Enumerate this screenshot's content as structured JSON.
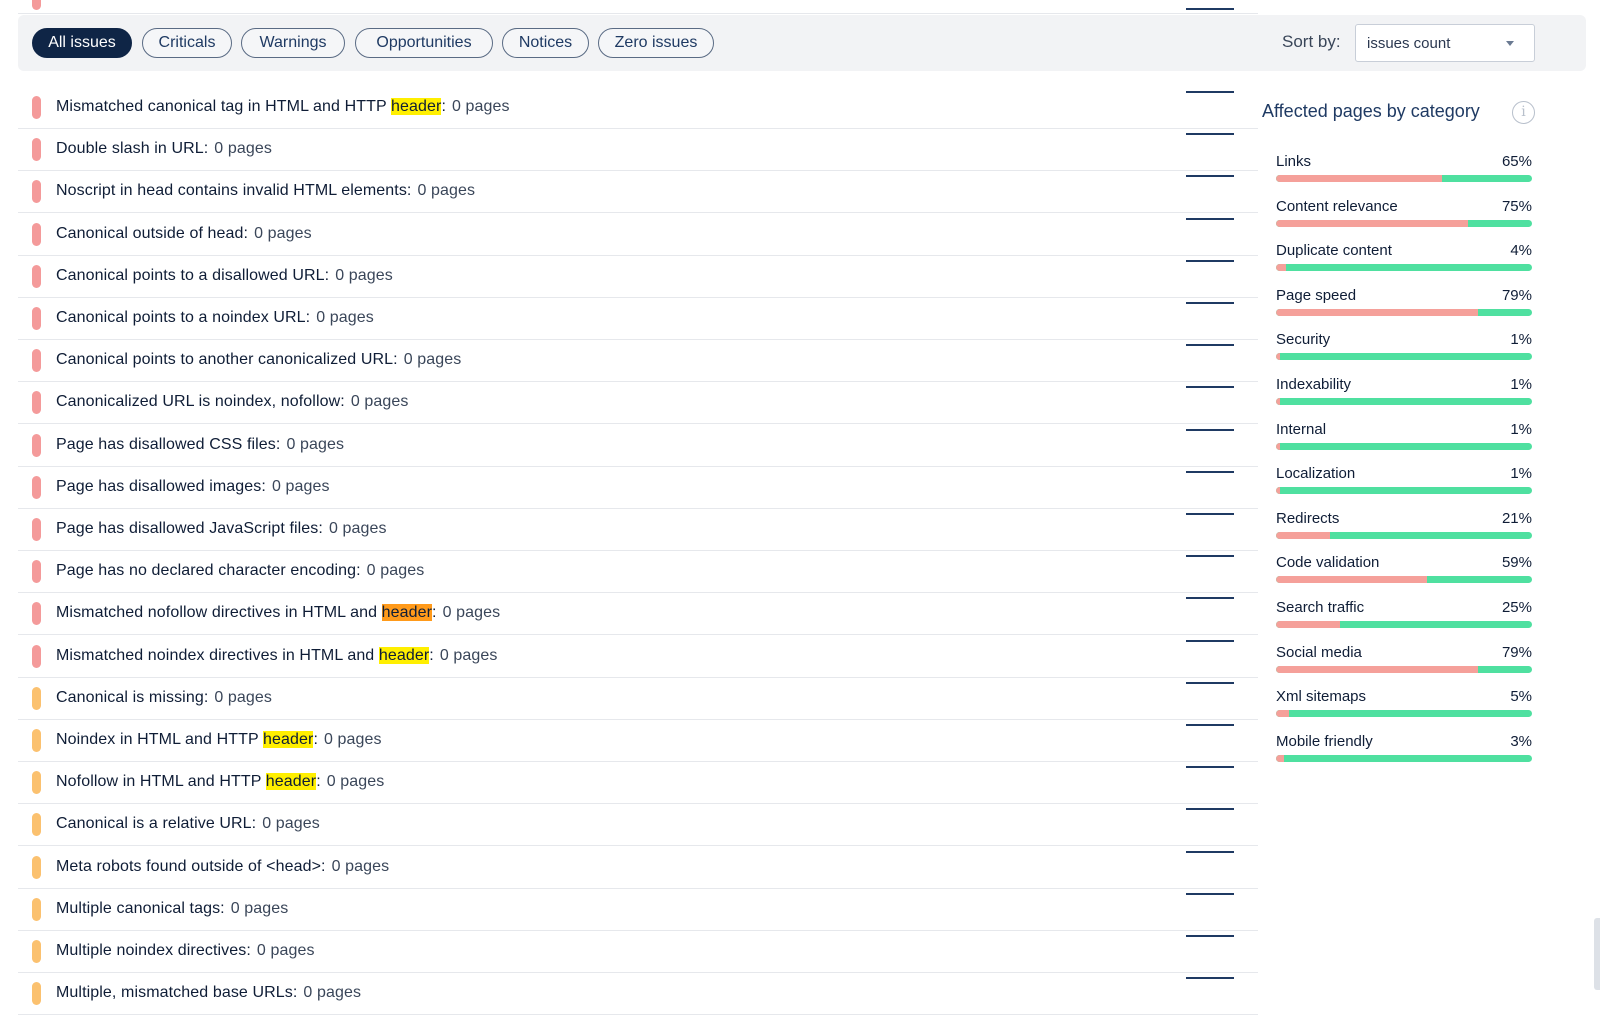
{
  "filters": {
    "chips": [
      {
        "label": "All issues",
        "active": true
      },
      {
        "label": "Criticals",
        "active": false
      },
      {
        "label": "Warnings",
        "active": false
      },
      {
        "label": "Opportunities",
        "active": false
      },
      {
        "label": "Notices",
        "active": false
      },
      {
        "label": "Zero issues",
        "active": false
      }
    ],
    "sort_label": "Sort by:",
    "sort_value": "issues count"
  },
  "issues": [
    {
      "severity": "critical",
      "parts": [
        {
          "text": "Mismatched canonical tag in HTML and HTTP "
        },
        {
          "text": "header",
          "hl": "yellow"
        },
        {
          "text": ":"
        }
      ],
      "count": "0 pages"
    },
    {
      "severity": "critical",
      "parts": [
        {
          "text": "Double slash in URL:"
        }
      ],
      "count": "0 pages"
    },
    {
      "severity": "critical",
      "parts": [
        {
          "text": "Noscript in head contains invalid HTML elements:"
        }
      ],
      "count": "0 pages"
    },
    {
      "severity": "critical",
      "parts": [
        {
          "text": "Canonical outside of head:"
        }
      ],
      "count": "0 pages"
    },
    {
      "severity": "critical",
      "parts": [
        {
          "text": "Canonical points to a disallowed URL:"
        }
      ],
      "count": "0 pages"
    },
    {
      "severity": "critical",
      "parts": [
        {
          "text": "Canonical points to a noindex URL:"
        }
      ],
      "count": "0 pages"
    },
    {
      "severity": "critical",
      "parts": [
        {
          "text": "Canonical points to another canonicalized URL:"
        }
      ],
      "count": "0 pages"
    },
    {
      "severity": "critical",
      "parts": [
        {
          "text": "Canonicalized URL is noindex, nofollow:"
        }
      ],
      "count": "0 pages"
    },
    {
      "severity": "critical",
      "parts": [
        {
          "text": "Page has disallowed CSS files:"
        }
      ],
      "count": "0 pages"
    },
    {
      "severity": "critical",
      "parts": [
        {
          "text": "Page has disallowed images:"
        }
      ],
      "count": "0 pages"
    },
    {
      "severity": "critical",
      "parts": [
        {
          "text": "Page has disallowed JavaScript files:"
        }
      ],
      "count": "0 pages"
    },
    {
      "severity": "critical",
      "parts": [
        {
          "text": "Page has no declared character encoding:"
        }
      ],
      "count": "0 pages"
    },
    {
      "severity": "critical",
      "parts": [
        {
          "text": "Mismatched nofollow directives in HTML and "
        },
        {
          "text": "header",
          "hl": "orange"
        },
        {
          "text": ":"
        }
      ],
      "count": "0 pages"
    },
    {
      "severity": "critical",
      "parts": [
        {
          "text": "Mismatched noindex directives in HTML and "
        },
        {
          "text": "header",
          "hl": "yellow"
        },
        {
          "text": ":"
        }
      ],
      "count": "0 pages"
    },
    {
      "severity": "warning",
      "parts": [
        {
          "text": "Canonical is missing:"
        }
      ],
      "count": "0 pages"
    },
    {
      "severity": "warning",
      "parts": [
        {
          "text": "Noindex in HTML and HTTP "
        },
        {
          "text": "header",
          "hl": "yellow"
        },
        {
          "text": ":"
        }
      ],
      "count": "0 pages"
    },
    {
      "severity": "warning",
      "parts": [
        {
          "text": "Nofollow in HTML and HTTP "
        },
        {
          "text": "header",
          "hl": "yellow"
        },
        {
          "text": ":"
        }
      ],
      "count": "0 pages"
    },
    {
      "severity": "warning",
      "parts": [
        {
          "text": "Canonical is a relative URL:"
        }
      ],
      "count": "0 pages"
    },
    {
      "severity": "warning",
      "parts": [
        {
          "text": "Meta robots found outside of <head>:"
        }
      ],
      "count": "0 pages"
    },
    {
      "severity": "warning",
      "parts": [
        {
          "text": "Multiple canonical tags:"
        }
      ],
      "count": "0 pages"
    },
    {
      "severity": "warning",
      "parts": [
        {
          "text": "Multiple noindex directives:"
        }
      ],
      "count": "0 pages"
    },
    {
      "severity": "warning",
      "parts": [
        {
          "text": "Multiple, mismatched base URLs:"
        }
      ],
      "count": "0 pages"
    }
  ],
  "panel": {
    "title": "Affected pages by category",
    "info_icon": "i",
    "categories": [
      {
        "name": "Links",
        "pct_label": "65%",
        "pct": 65
      },
      {
        "name": "Content relevance",
        "pct_label": "75%",
        "pct": 75
      },
      {
        "name": "Duplicate content",
        "pct_label": "4%",
        "pct": 4
      },
      {
        "name": "Page speed",
        "pct_label": "79%",
        "pct": 79
      },
      {
        "name": "Security",
        "pct_label": "1%",
        "pct": 1
      },
      {
        "name": "Indexability",
        "pct_label": "1%",
        "pct": 1
      },
      {
        "name": "Internal",
        "pct_label": "1%",
        "pct": 1
      },
      {
        "name": "Localization",
        "pct_label": "1%",
        "pct": 1
      },
      {
        "name": "Redirects",
        "pct_label": "21%",
        "pct": 21
      },
      {
        "name": "Code validation",
        "pct_label": "59%",
        "pct": 59
      },
      {
        "name": "Search traffic",
        "pct_label": "25%",
        "pct": 25
      },
      {
        "name": "Social media",
        "pct_label": "79%",
        "pct": 79
      },
      {
        "name": "Xml sitemaps",
        "pct_label": "5%",
        "pct": 5
      },
      {
        "name": "Mobile friendly",
        "pct_label": "3%",
        "pct": 3
      }
    ]
  },
  "colors": {
    "critical": "#f49a9a",
    "warning": "#fbc16f",
    "bar_affected": "#f5a09a",
    "bar_ok": "#4fe0a0",
    "chip_active": "#0f2546"
  }
}
